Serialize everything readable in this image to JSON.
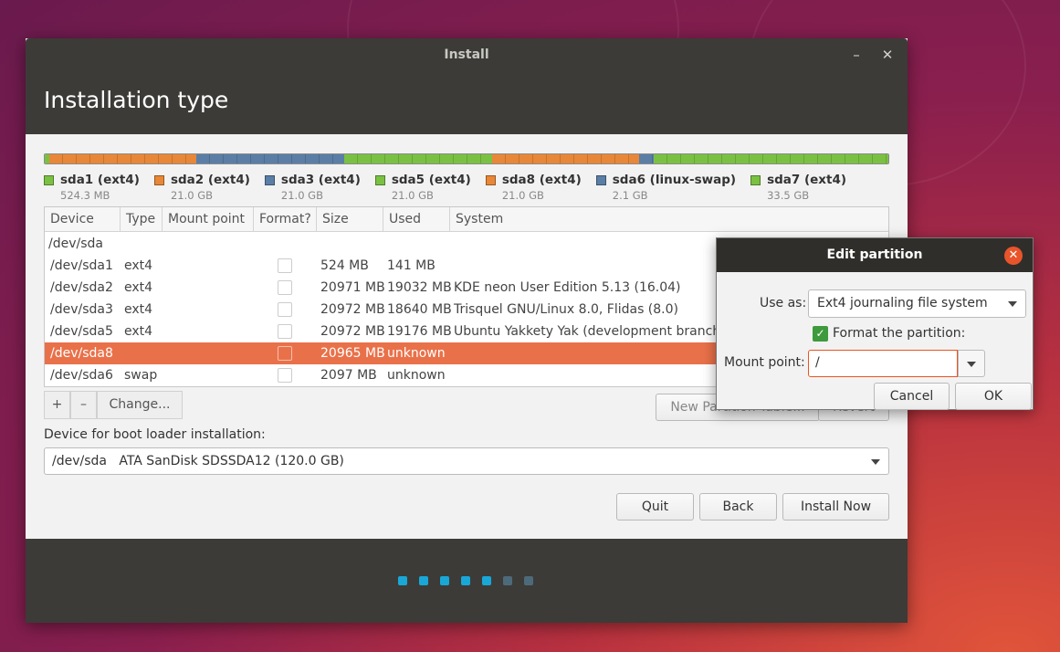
{
  "window": {
    "title": "Install",
    "minimize": "–",
    "close": "✕",
    "heading": "Installation type"
  },
  "colors": {
    "ext4_green": "#7ac143",
    "ext4_orange": "#e88737",
    "ext4_blue": "#5b7ea6",
    "accent": "#e95420"
  },
  "legend": [
    {
      "label": "sda1 (ext4)",
      "size": "524.3 MB",
      "color": "#7ac143"
    },
    {
      "label": "sda2 (ext4)",
      "size": "21.0 GB",
      "color": "#e88737"
    },
    {
      "label": "sda3 (ext4)",
      "size": "21.0 GB",
      "color": "#5b7ea6"
    },
    {
      "label": "sda5 (ext4)",
      "size": "21.0 GB",
      "color": "#7ac143"
    },
    {
      "label": "sda8 (ext4)",
      "size": "21.0 GB",
      "color": "#e88737"
    },
    {
      "label": "sda6 (linux-swap)",
      "size": "2.1 GB",
      "color": "#5b7ea6"
    },
    {
      "label": "sda7 (ext4)",
      "size": "33.5 GB",
      "color": "#7ac143"
    }
  ],
  "table": {
    "columns": [
      "Device",
      "Type",
      "Mount point",
      "Format?",
      "Size",
      "Used",
      "System"
    ],
    "group": "/dev/sda",
    "rows": [
      {
        "device": "/dev/sda1",
        "type": "ext4",
        "mount": "",
        "size": "524 MB",
        "used": "141 MB",
        "system": "",
        "selected": false
      },
      {
        "device": "/dev/sda2",
        "type": "ext4",
        "mount": "",
        "size": "20971 MB",
        "used": "19032 MB",
        "system": "KDE neon User Edition 5.13 (16.04)",
        "selected": false
      },
      {
        "device": "/dev/sda3",
        "type": "ext4",
        "mount": "",
        "size": "20972 MB",
        "used": "18640 MB",
        "system": "Trisquel GNU/Linux 8.0, Flidas (8.0)",
        "selected": false
      },
      {
        "device": "/dev/sda5",
        "type": "ext4",
        "mount": "",
        "size": "20972 MB",
        "used": "19176 MB",
        "system": "Ubuntu Yakkety Yak (development branch)",
        "selected": false
      },
      {
        "device": "/dev/sda8",
        "type": "",
        "mount": "",
        "size": "20965 MB",
        "used": "unknown",
        "system": "",
        "selected": true
      },
      {
        "device": "/dev/sda6",
        "type": "swap",
        "mount": "",
        "size": "2097 MB",
        "used": "unknown",
        "system": "",
        "selected": false
      }
    ]
  },
  "toolbar": {
    "add": "+",
    "remove": "–",
    "change": "Change...",
    "new_table": "New Partition Table...",
    "revert": "Revert"
  },
  "boot": {
    "label": "Device for boot loader installation:",
    "value": "/dev/sda   ATA SanDisk SDSSDA12 (120.0 GB)"
  },
  "buttons": {
    "quit": "Quit",
    "back": "Back",
    "install": "Install Now"
  },
  "progress_dots": [
    {
      "active": true
    },
    {
      "active": true
    },
    {
      "active": true
    },
    {
      "active": true
    },
    {
      "active": true
    },
    {
      "active": false
    },
    {
      "active": false
    }
  ],
  "dialog": {
    "title": "Edit partition",
    "close": "✕",
    "use_as_label": "Use as:",
    "use_as_value": "Ext4 journaling file system",
    "format_label": "Format the partition:",
    "format_checked": true,
    "mount_label": "Mount point:",
    "mount_value": "/",
    "cancel": "Cancel",
    "ok": "OK"
  }
}
